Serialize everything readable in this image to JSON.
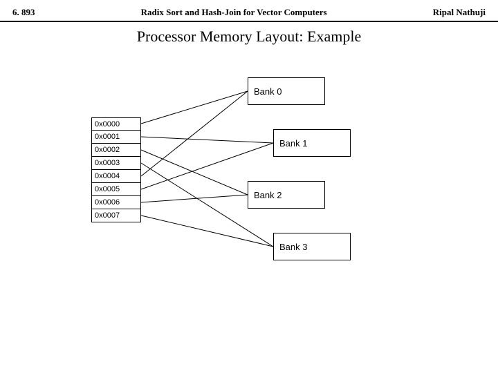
{
  "header": {
    "left": "6. 893",
    "center": "Radix Sort and Hash-Join for Vector Computers",
    "right": "Ripal Nathuji"
  },
  "title": "Processor Memory Layout: Example",
  "addresses": [
    "0x0000",
    "0x0001",
    "0x0002",
    "0x0003",
    "0x0004",
    "0x0005",
    "0x0006",
    "0x0007"
  ],
  "banks": [
    "Bank 0",
    "Bank 1",
    "Bank 2",
    "Bank 3"
  ]
}
